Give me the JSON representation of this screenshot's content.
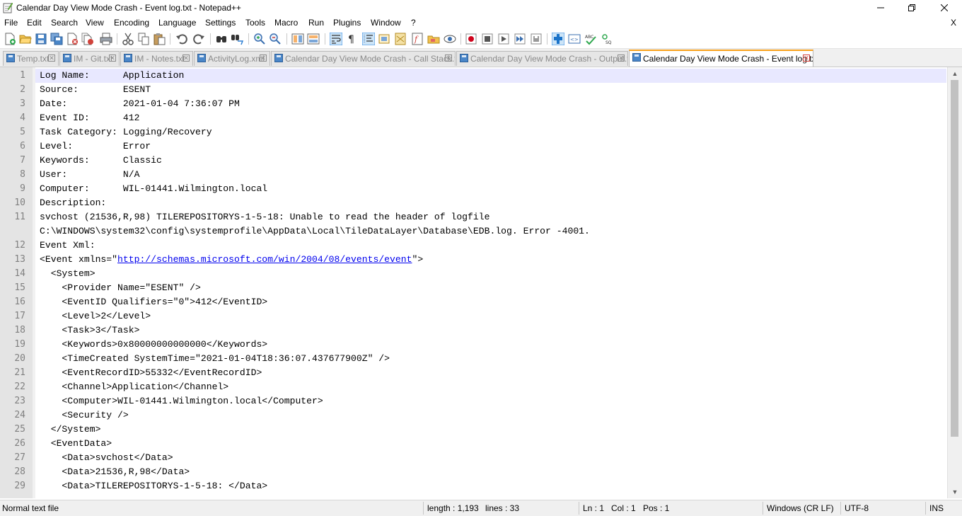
{
  "window": {
    "title": "Calendar Day View Mode Crash - Event log.txt - Notepad++",
    "controls": {
      "minimize": "—",
      "maximize": "❐",
      "close": "✕"
    }
  },
  "menu": {
    "items": [
      "File",
      "Edit",
      "Search",
      "View",
      "Encoding",
      "Language",
      "Settings",
      "Tools",
      "Macro",
      "Run",
      "Plugins",
      "Window",
      "?"
    ],
    "close_doc": "X"
  },
  "toolbar": {
    "icons": [
      "new-file-icon",
      "open-file-icon",
      "save-icon",
      "save-all-icon",
      "close-icon",
      "close-all-icon",
      "print-icon",
      "cut-icon",
      "copy-icon",
      "paste-icon",
      "undo-icon",
      "redo-icon",
      "find-icon",
      "replace-icon",
      "zoom-in-icon",
      "zoom-out-icon",
      "sync-vertical-icon",
      "sync-horizontal-icon",
      "word-wrap-icon",
      "show-all-chars-icon",
      "indent-guide-icon",
      "udl-icon",
      "doc-map-icon",
      "function-list-icon",
      "folder-workspace-icon",
      "monitoring-icon",
      "record-macro-icon",
      "stop-macro-icon",
      "play-macro-icon",
      "play-multiple-icon",
      "save-macro-icon",
      "plugin-icon",
      "xml-tools-icon",
      "spell-check-icon",
      "sql-icon"
    ]
  },
  "tabs": [
    {
      "label": "Temp.txt",
      "active": false
    },
    {
      "label": "IM - Git.txt",
      "active": false
    },
    {
      "label": "IM - Notes.txt",
      "active": false
    },
    {
      "label": "ActivityLog.xml",
      "active": false
    },
    {
      "label": "Calendar Day View Mode Crash - Call Stack.txt",
      "active": false
    },
    {
      "label": "Calendar Day View Mode Crash - Output.txt",
      "active": false
    },
    {
      "label": "Calendar Day View Mode Crash - Event log.txt",
      "active": true
    }
  ],
  "editor": {
    "lines": [
      {
        "n": "1",
        "text": "Log Name:      Application"
      },
      {
        "n": "2",
        "text": "Source:        ESENT"
      },
      {
        "n": "3",
        "text": "Date:          2021-01-04 7:36:07 PM"
      },
      {
        "n": "4",
        "text": "Event ID:      412"
      },
      {
        "n": "5",
        "text": "Task Category: Logging/Recovery"
      },
      {
        "n": "6",
        "text": "Level:         Error"
      },
      {
        "n": "7",
        "text": "Keywords:      Classic"
      },
      {
        "n": "8",
        "text": "User:          N/A"
      },
      {
        "n": "9",
        "text": "Computer:      WIL-01441.Wilmington.local"
      },
      {
        "n": "10",
        "text": "Description:"
      },
      {
        "n": "11",
        "text": "svchost (21536,R,98) TILEREPOSITORYS-1-5-18: Unable to read the header of logfile"
      },
      {
        "n": "",
        "text": "C:\\WINDOWS\\system32\\config\\systemprofile\\AppData\\Local\\TileDataLayer\\Database\\EDB.log. Error -4001."
      },
      {
        "n": "12",
        "text": "Event Xml:"
      },
      {
        "n": "13",
        "pre": "<Event xmlns=\"",
        "url": "http://schemas.microsoft.com/win/2004/08/events/event",
        "post": "\">"
      },
      {
        "n": "14",
        "text": "  <System>"
      },
      {
        "n": "15",
        "text": "    <Provider Name=\"ESENT\" />"
      },
      {
        "n": "16",
        "text": "    <EventID Qualifiers=\"0\">412</EventID>"
      },
      {
        "n": "17",
        "text": "    <Level>2</Level>"
      },
      {
        "n": "18",
        "text": "    <Task>3</Task>"
      },
      {
        "n": "19",
        "text": "    <Keywords>0x80000000000000</Keywords>"
      },
      {
        "n": "20",
        "text": "    <TimeCreated SystemTime=\"2021-01-04T18:36:07.437677900Z\" />"
      },
      {
        "n": "21",
        "text": "    <EventRecordID>55332</EventRecordID>"
      },
      {
        "n": "22",
        "text": "    <Channel>Application</Channel>"
      },
      {
        "n": "23",
        "text": "    <Computer>WIL-01441.Wilmington.local</Computer>"
      },
      {
        "n": "24",
        "text": "    <Security />"
      },
      {
        "n": "25",
        "text": "  </System>"
      },
      {
        "n": "26",
        "text": "  <EventData>"
      },
      {
        "n": "27",
        "text": "    <Data>svchost</Data>"
      },
      {
        "n": "28",
        "text": "    <Data>21536,R,98</Data>"
      },
      {
        "n": "29",
        "text": "    <Data>TILEREPOSITORYS-1-5-18: </Data>"
      }
    ]
  },
  "status": {
    "file_type": "Normal text file",
    "length": "length : 1,193",
    "lines": "lines : 33",
    "ln": "Ln : 1",
    "col": "Col : 1",
    "pos": "Pos : 1",
    "eol": "Windows (CR LF)",
    "encoding": "UTF-8",
    "mode": "INS"
  },
  "colors": {
    "accent_tab": "#f9a11b",
    "gutter": "#e4e4e4",
    "current_line": "#e8e8ff",
    "link": "#0000ee"
  }
}
